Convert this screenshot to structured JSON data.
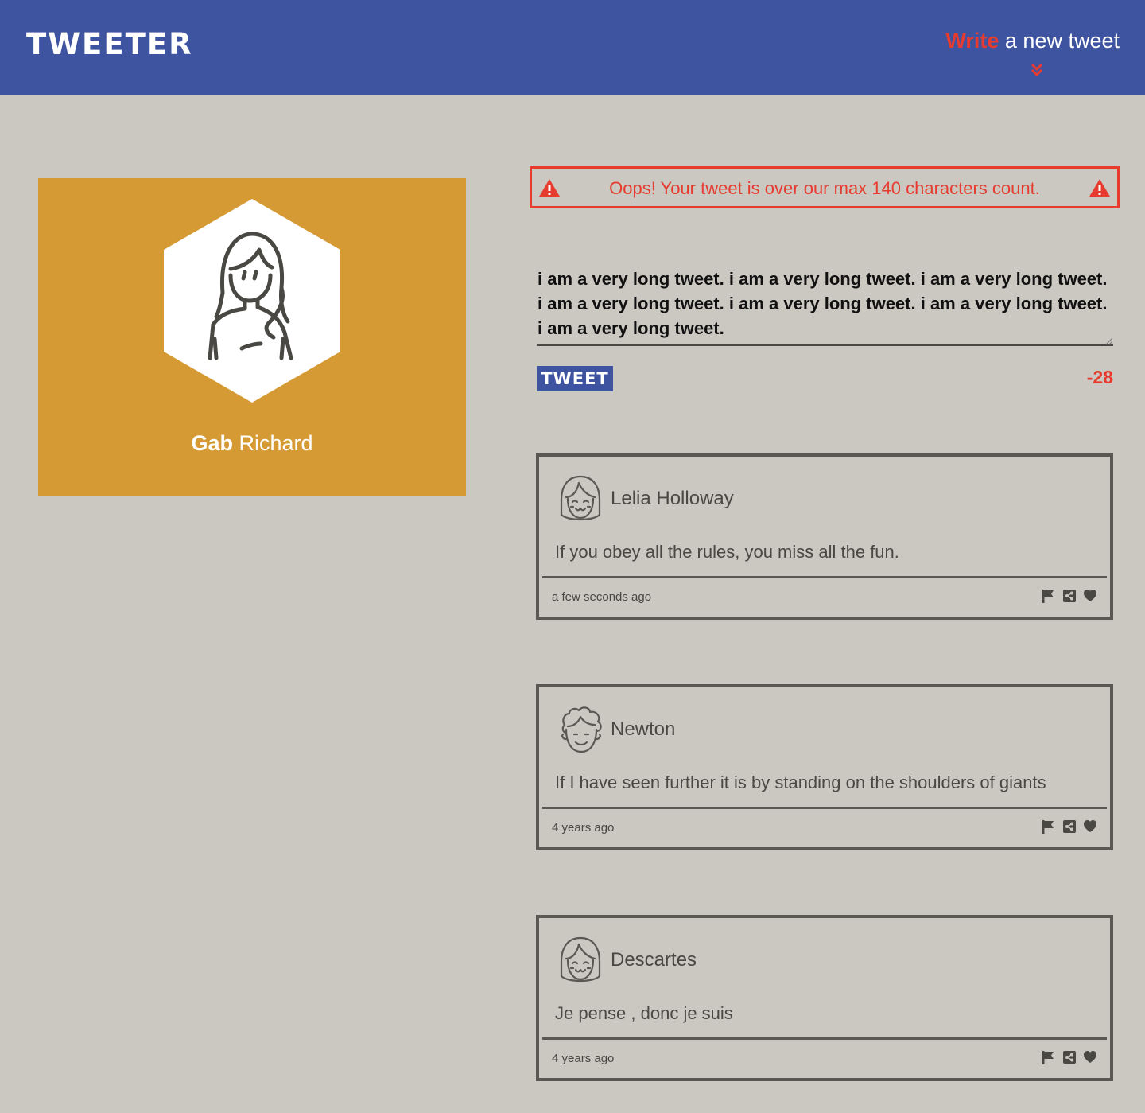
{
  "header": {
    "logo": "TWEETER",
    "compose_accent": "Write",
    "compose_rest": " a new tweet"
  },
  "profile": {
    "first_name": "Gab",
    "last_name": " Richard"
  },
  "error": {
    "message": "Oops! Your tweet is over our max 140 characters count."
  },
  "composer": {
    "text": "i am a very long tweet. i am a very long tweet. i am a very long tweet. i am a very long tweet. i am a very long tweet. i am a very long tweet. i am a very long tweet.",
    "button_label": "TWEET",
    "counter": "-28"
  },
  "tweets": [
    {
      "name": "Lelia Holloway",
      "body": "If you obey all the rules, you miss all the fun.",
      "time": "a few seconds ago",
      "avatar_icon": "girl-avatar-icon"
    },
    {
      "name": "Newton",
      "body": "If I have seen further it is by standing on the shoulders of giants",
      "time": "4 years ago",
      "avatar_icon": "curly-hair-avatar-icon"
    },
    {
      "name": "Descartes",
      "body": "Je pense , donc je suis",
      "time": "4 years ago",
      "avatar_icon": "girl-avatar-icon"
    }
  ],
  "colors": {
    "nav": "#3e54a0",
    "accent": "#e63b2e",
    "background": "#cbc7c1",
    "profile_card": "#d59a33",
    "ink": "#4a4843"
  }
}
